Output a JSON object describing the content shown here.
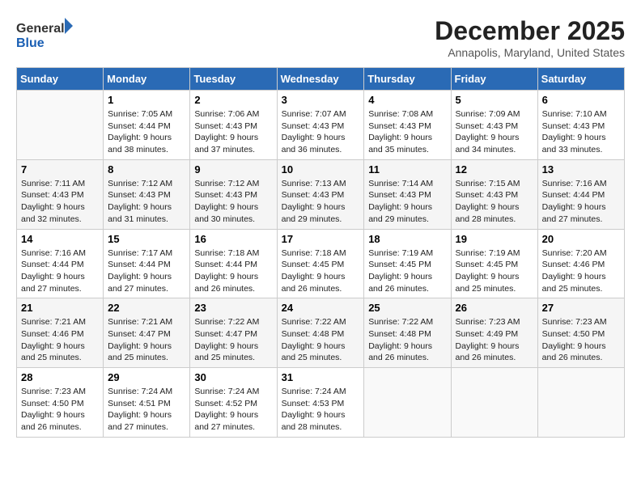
{
  "header": {
    "logo_line1": "General",
    "logo_line2": "Blue",
    "title": "December 2025",
    "subtitle": "Annapolis, Maryland, United States"
  },
  "days_of_week": [
    "Sunday",
    "Monday",
    "Tuesday",
    "Wednesday",
    "Thursday",
    "Friday",
    "Saturday"
  ],
  "weeks": [
    [
      {
        "day": "",
        "sunrise": "",
        "sunset": "",
        "daylight": ""
      },
      {
        "day": "1",
        "sunrise": "Sunrise: 7:05 AM",
        "sunset": "Sunset: 4:44 PM",
        "daylight": "Daylight: 9 hours and 38 minutes."
      },
      {
        "day": "2",
        "sunrise": "Sunrise: 7:06 AM",
        "sunset": "Sunset: 4:43 PM",
        "daylight": "Daylight: 9 hours and 37 minutes."
      },
      {
        "day": "3",
        "sunrise": "Sunrise: 7:07 AM",
        "sunset": "Sunset: 4:43 PM",
        "daylight": "Daylight: 9 hours and 36 minutes."
      },
      {
        "day": "4",
        "sunrise": "Sunrise: 7:08 AM",
        "sunset": "Sunset: 4:43 PM",
        "daylight": "Daylight: 9 hours and 35 minutes."
      },
      {
        "day": "5",
        "sunrise": "Sunrise: 7:09 AM",
        "sunset": "Sunset: 4:43 PM",
        "daylight": "Daylight: 9 hours and 34 minutes."
      },
      {
        "day": "6",
        "sunrise": "Sunrise: 7:10 AM",
        "sunset": "Sunset: 4:43 PM",
        "daylight": "Daylight: 9 hours and 33 minutes."
      }
    ],
    [
      {
        "day": "7",
        "sunrise": "Sunrise: 7:11 AM",
        "sunset": "Sunset: 4:43 PM",
        "daylight": "Daylight: 9 hours and 32 minutes."
      },
      {
        "day": "8",
        "sunrise": "Sunrise: 7:12 AM",
        "sunset": "Sunset: 4:43 PM",
        "daylight": "Daylight: 9 hours and 31 minutes."
      },
      {
        "day": "9",
        "sunrise": "Sunrise: 7:12 AM",
        "sunset": "Sunset: 4:43 PM",
        "daylight": "Daylight: 9 hours and 30 minutes."
      },
      {
        "day": "10",
        "sunrise": "Sunrise: 7:13 AM",
        "sunset": "Sunset: 4:43 PM",
        "daylight": "Daylight: 9 hours and 29 minutes."
      },
      {
        "day": "11",
        "sunrise": "Sunrise: 7:14 AM",
        "sunset": "Sunset: 4:43 PM",
        "daylight": "Daylight: 9 hours and 29 minutes."
      },
      {
        "day": "12",
        "sunrise": "Sunrise: 7:15 AM",
        "sunset": "Sunset: 4:43 PM",
        "daylight": "Daylight: 9 hours and 28 minutes."
      },
      {
        "day": "13",
        "sunrise": "Sunrise: 7:16 AM",
        "sunset": "Sunset: 4:44 PM",
        "daylight": "Daylight: 9 hours and 27 minutes."
      }
    ],
    [
      {
        "day": "14",
        "sunrise": "Sunrise: 7:16 AM",
        "sunset": "Sunset: 4:44 PM",
        "daylight": "Daylight: 9 hours and 27 minutes."
      },
      {
        "day": "15",
        "sunrise": "Sunrise: 7:17 AM",
        "sunset": "Sunset: 4:44 PM",
        "daylight": "Daylight: 9 hours and 27 minutes."
      },
      {
        "day": "16",
        "sunrise": "Sunrise: 7:18 AM",
        "sunset": "Sunset: 4:44 PM",
        "daylight": "Daylight: 9 hours and 26 minutes."
      },
      {
        "day": "17",
        "sunrise": "Sunrise: 7:18 AM",
        "sunset": "Sunset: 4:45 PM",
        "daylight": "Daylight: 9 hours and 26 minutes."
      },
      {
        "day": "18",
        "sunrise": "Sunrise: 7:19 AM",
        "sunset": "Sunset: 4:45 PM",
        "daylight": "Daylight: 9 hours and 26 minutes."
      },
      {
        "day": "19",
        "sunrise": "Sunrise: 7:19 AM",
        "sunset": "Sunset: 4:45 PM",
        "daylight": "Daylight: 9 hours and 25 minutes."
      },
      {
        "day": "20",
        "sunrise": "Sunrise: 7:20 AM",
        "sunset": "Sunset: 4:46 PM",
        "daylight": "Daylight: 9 hours and 25 minutes."
      }
    ],
    [
      {
        "day": "21",
        "sunrise": "Sunrise: 7:21 AM",
        "sunset": "Sunset: 4:46 PM",
        "daylight": "Daylight: 9 hours and 25 minutes."
      },
      {
        "day": "22",
        "sunrise": "Sunrise: 7:21 AM",
        "sunset": "Sunset: 4:47 PM",
        "daylight": "Daylight: 9 hours and 25 minutes."
      },
      {
        "day": "23",
        "sunrise": "Sunrise: 7:22 AM",
        "sunset": "Sunset: 4:47 PM",
        "daylight": "Daylight: 9 hours and 25 minutes."
      },
      {
        "day": "24",
        "sunrise": "Sunrise: 7:22 AM",
        "sunset": "Sunset: 4:48 PM",
        "daylight": "Daylight: 9 hours and 25 minutes."
      },
      {
        "day": "25",
        "sunrise": "Sunrise: 7:22 AM",
        "sunset": "Sunset: 4:48 PM",
        "daylight": "Daylight: 9 hours and 26 minutes."
      },
      {
        "day": "26",
        "sunrise": "Sunrise: 7:23 AM",
        "sunset": "Sunset: 4:49 PM",
        "daylight": "Daylight: 9 hours and 26 minutes."
      },
      {
        "day": "27",
        "sunrise": "Sunrise: 7:23 AM",
        "sunset": "Sunset: 4:50 PM",
        "daylight": "Daylight: 9 hours and 26 minutes."
      }
    ],
    [
      {
        "day": "28",
        "sunrise": "Sunrise: 7:23 AM",
        "sunset": "Sunset: 4:50 PM",
        "daylight": "Daylight: 9 hours and 26 minutes."
      },
      {
        "day": "29",
        "sunrise": "Sunrise: 7:24 AM",
        "sunset": "Sunset: 4:51 PM",
        "daylight": "Daylight: 9 hours and 27 minutes."
      },
      {
        "day": "30",
        "sunrise": "Sunrise: 7:24 AM",
        "sunset": "Sunset: 4:52 PM",
        "daylight": "Daylight: 9 hours and 27 minutes."
      },
      {
        "day": "31",
        "sunrise": "Sunrise: 7:24 AM",
        "sunset": "Sunset: 4:53 PM",
        "daylight": "Daylight: 9 hours and 28 minutes."
      },
      {
        "day": "",
        "sunrise": "",
        "sunset": "",
        "daylight": ""
      },
      {
        "day": "",
        "sunrise": "",
        "sunset": "",
        "daylight": ""
      },
      {
        "day": "",
        "sunrise": "",
        "sunset": "",
        "daylight": ""
      }
    ]
  ]
}
